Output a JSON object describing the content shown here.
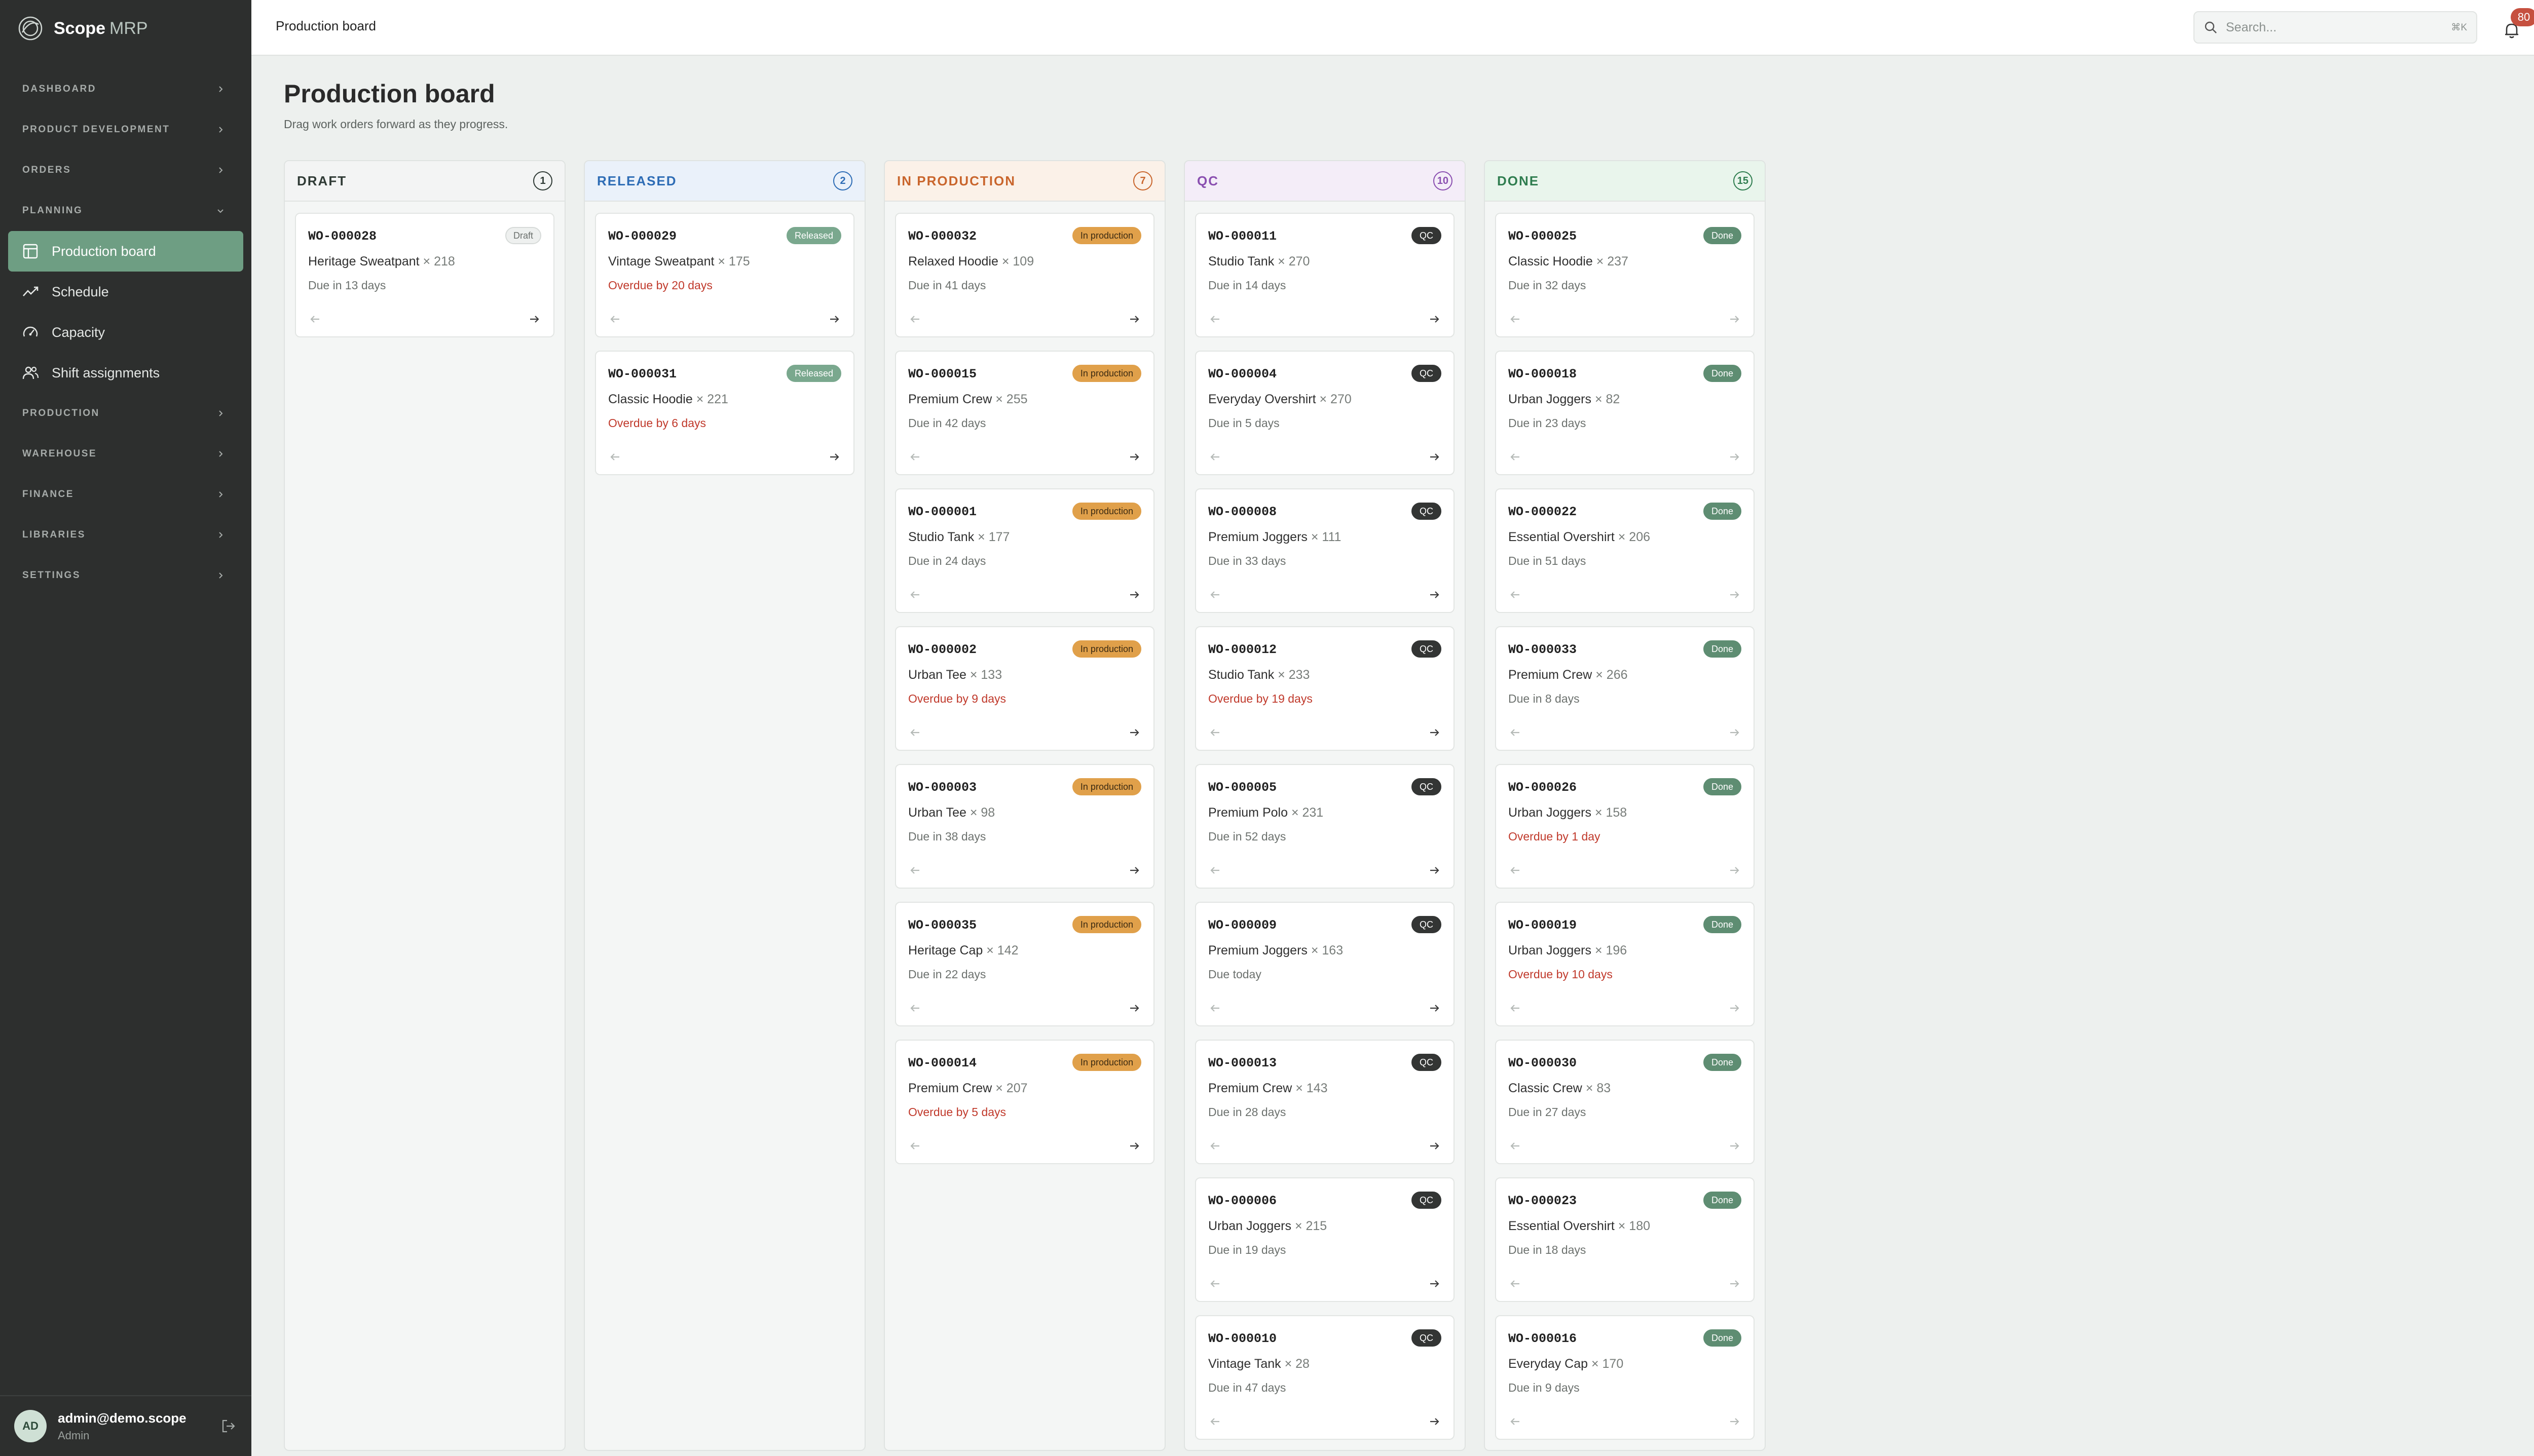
{
  "app": {
    "brand": "Scope",
    "brand_suffix": "MRP"
  },
  "topbar": {
    "title": "Production board",
    "search_placeholder": "Search...",
    "search_shortcut": "⌘K",
    "notification_count": "80"
  },
  "sidebar": {
    "sections_top": [
      {
        "label": "DASHBOARD"
      },
      {
        "label": "PRODUCT DEVELOPMENT"
      },
      {
        "label": "ORDERS"
      }
    ],
    "planning": {
      "label": "PLANNING",
      "items": [
        {
          "label": "Production board",
          "icon": "board-icon",
          "active": true
        },
        {
          "label": "Schedule",
          "icon": "trend-icon",
          "active": false
        },
        {
          "label": "Capacity",
          "icon": "gauge-icon",
          "active": false
        },
        {
          "label": "Shift assignments",
          "icon": "users-icon",
          "active": false
        }
      ]
    },
    "sections_bottom": [
      {
        "label": "PRODUCTION"
      },
      {
        "label": "WAREHOUSE"
      },
      {
        "label": "FINANCE"
      },
      {
        "label": "LIBRARIES"
      },
      {
        "label": "SETTINGS"
      }
    ],
    "user": {
      "initials": "AD",
      "email": "admin@demo.scope",
      "role": "Admin"
    }
  },
  "page": {
    "title": "Production board",
    "subtitle": "Drag work orders forward as they progress."
  },
  "colors": {
    "accent": "#6e9e83",
    "sidebar_bg": "#2d2f2e",
    "overdue": "#c0392b"
  },
  "columns": [
    {
      "key": "draft",
      "title": "DRAFT",
      "count": "1",
      "title_color": "#2f3a35",
      "head_bg": "#f3f4f4",
      "badge": {
        "label": "Draft",
        "bg": "#eef0ef",
        "fg": "#6b706d",
        "border": "#d6dad8"
      },
      "cards": [
        {
          "code": "WO-000028",
          "product": "Heritage Sweatpant",
          "qty": "× 218",
          "due": "Due in 13 days",
          "overdue": false
        }
      ]
    },
    {
      "key": "released",
      "title": "RELEASED",
      "count": "2",
      "title_color": "#2d6cb5",
      "head_bg": "#eaf1fa",
      "badge": {
        "label": "Released",
        "bg": "#7aa88e",
        "fg": "#ffffff",
        "border": "#7aa88e"
      },
      "cards": [
        {
          "code": "WO-000029",
          "product": "Vintage Sweatpant",
          "qty": "× 175",
          "due": "Overdue by 20 days",
          "overdue": true
        },
        {
          "code": "WO-000031",
          "product": "Classic Hoodie",
          "qty": "× 221",
          "due": "Overdue by 6 days",
          "overdue": true
        }
      ]
    },
    {
      "key": "in_production",
      "title": "IN PRODUCTION",
      "count": "7",
      "title_color": "#c9652c",
      "head_bg": "#fbf1e8",
      "badge": {
        "label": "In production",
        "bg": "#e0a04a",
        "fg": "#3b2a12",
        "border": "#e0a04a"
      },
      "cards": [
        {
          "code": "WO-000032",
          "product": "Relaxed Hoodie",
          "qty": "× 109",
          "due": "Due in 41 days",
          "overdue": false
        },
        {
          "code": "WO-000015",
          "product": "Premium Crew",
          "qty": "× 255",
          "due": "Due in 42 days",
          "overdue": false
        },
        {
          "code": "WO-000001",
          "product": "Studio Tank",
          "qty": "× 177",
          "due": "Due in 24 days",
          "overdue": false
        },
        {
          "code": "WO-000002",
          "product": "Urban Tee",
          "qty": "× 133",
          "due": "Overdue by 9 days",
          "overdue": true
        },
        {
          "code": "WO-000003",
          "product": "Urban Tee",
          "qty": "× 98",
          "due": "Due in 38 days",
          "overdue": false
        },
        {
          "code": "WO-000035",
          "product": "Heritage Cap",
          "qty": "× 142",
          "due": "Due in 22 days",
          "overdue": false
        },
        {
          "code": "WO-000014",
          "product": "Premium Crew",
          "qty": "× 207",
          "due": "Overdue by 5 days",
          "overdue": true
        }
      ]
    },
    {
      "key": "qc",
      "title": "QC",
      "count": "10",
      "title_color": "#8a4fb0",
      "head_bg": "#f4edf8",
      "badge": {
        "label": "QC",
        "bg": "#333534",
        "fg": "#ffffff",
        "border": "#333534"
      },
      "cards": [
        {
          "code": "WO-000011",
          "product": "Studio Tank",
          "qty": "× 270",
          "due": "Due in 14 days",
          "overdue": false
        },
        {
          "code": "WO-000004",
          "product": "Everyday Overshirt",
          "qty": "× 270",
          "due": "Due in 5 days",
          "overdue": false
        },
        {
          "code": "WO-000008",
          "product": "Premium Joggers",
          "qty": "× 111",
          "due": "Due in 33 days",
          "overdue": false
        },
        {
          "code": "WO-000012",
          "product": "Studio Tank",
          "qty": "× 233",
          "due": "Overdue by 19 days",
          "overdue": true
        },
        {
          "code": "WO-000005",
          "product": "Premium Polo",
          "qty": "× 231",
          "due": "Due in 52 days",
          "overdue": false
        },
        {
          "code": "WO-000009",
          "product": "Premium Joggers",
          "qty": "× 163",
          "due": "Due today",
          "overdue": false
        },
        {
          "code": "WO-000013",
          "product": "Premium Crew",
          "qty": "× 143",
          "due": "Due in 28 days",
          "overdue": false
        },
        {
          "code": "WO-000006",
          "product": "Urban Joggers",
          "qty": "× 215",
          "due": "Due in 19 days",
          "overdue": false
        },
        {
          "code": "WO-000010",
          "product": "Vintage Tank",
          "qty": "× 28",
          "due": "Due in 47 days",
          "overdue": false
        }
      ]
    },
    {
      "key": "done",
      "title": "DONE",
      "count": "15",
      "title_color": "#2f7d4f",
      "head_bg": "#e9f5ec",
      "badge": {
        "label": "Done",
        "bg": "#5e8d72",
        "fg": "#ffffff",
        "border": "#5e8d72"
      },
      "cards": [
        {
          "code": "WO-000025",
          "product": "Classic Hoodie",
          "qty": "× 237",
          "due": "Due in 32 days",
          "overdue": false
        },
        {
          "code": "WO-000018",
          "product": "Urban Joggers",
          "qty": "× 82",
          "due": "Due in 23 days",
          "overdue": false
        },
        {
          "code": "WO-000022",
          "product": "Essential Overshirt",
          "qty": "× 206",
          "due": "Due in 51 days",
          "overdue": false
        },
        {
          "code": "WO-000033",
          "product": "Premium Crew",
          "qty": "× 266",
          "due": "Due in 8 days",
          "overdue": false
        },
        {
          "code": "WO-000026",
          "product": "Urban Joggers",
          "qty": "× 158",
          "due": "Overdue by 1 day",
          "overdue": true
        },
        {
          "code": "WO-000019",
          "product": "Urban Joggers",
          "qty": "× 196",
          "due": "Overdue by 10 days",
          "overdue": true
        },
        {
          "code": "WO-000030",
          "product": "Classic Crew",
          "qty": "× 83",
          "due": "Due in 27 days",
          "overdue": false
        },
        {
          "code": "WO-000023",
          "product": "Essential Overshirt",
          "qty": "× 180",
          "due": "Due in 18 days",
          "overdue": false
        },
        {
          "code": "WO-000016",
          "product": "Everyday Cap",
          "qty": "× 170",
          "due": "Due in 9 days",
          "overdue": false
        }
      ]
    }
  ]
}
